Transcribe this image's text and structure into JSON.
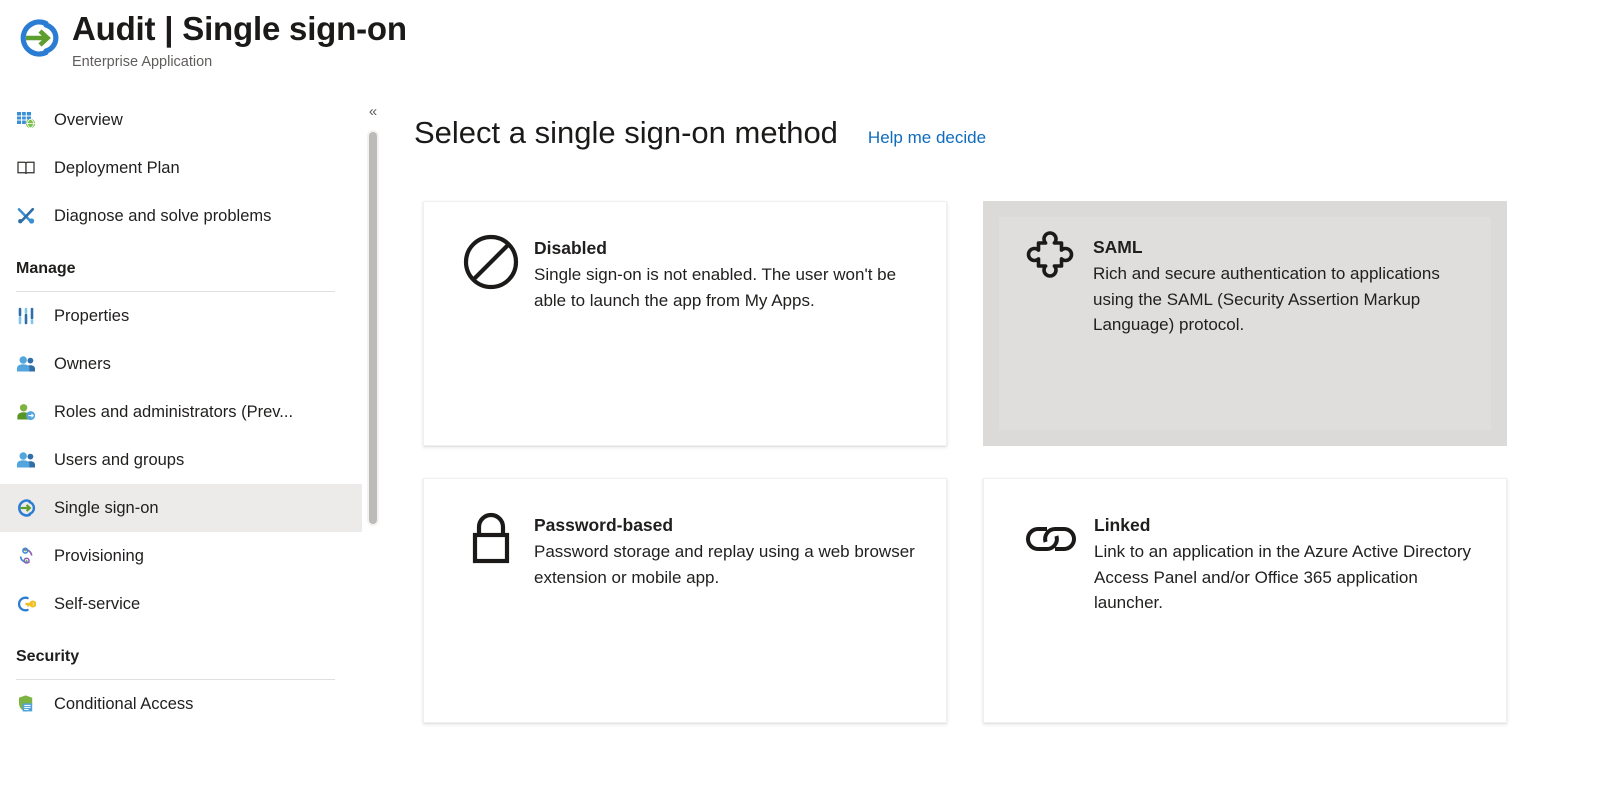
{
  "header": {
    "title": "Audit | Single sign-on",
    "subtitle": "Enterprise Application",
    "logo_icon": "single-sign-on-logo-icon"
  },
  "sidebar": {
    "items": [
      {
        "label": "Overview",
        "icon": "overview-grid-globe-icon",
        "selected": false
      },
      {
        "label": "Deployment Plan",
        "icon": "book-icon",
        "selected": false
      },
      {
        "label": "Diagnose and solve problems",
        "icon": "wrench-screwdriver-icon",
        "selected": false
      }
    ],
    "groups": [
      {
        "title": "Manage",
        "items": [
          {
            "label": "Properties",
            "icon": "sliders-icon",
            "selected": false
          },
          {
            "label": "Owners",
            "icon": "people-icon",
            "selected": false
          },
          {
            "label": "Roles and administrators (Prev...",
            "icon": "person-badge-icon",
            "selected": false
          },
          {
            "label": "Users and groups",
            "icon": "people-icon",
            "selected": false
          },
          {
            "label": "Single sign-on",
            "icon": "single-sign-on-icon",
            "selected": true
          },
          {
            "label": "Provisioning",
            "icon": "provisioning-cycle-icon",
            "selected": false
          },
          {
            "label": "Self-service",
            "icon": "key-circle-icon",
            "selected": false
          }
        ]
      },
      {
        "title": "Security",
        "items": [
          {
            "label": "Conditional Access",
            "icon": "shield-document-icon",
            "selected": false
          }
        ]
      }
    ]
  },
  "splitter": {
    "collapse_icon": "chevron-double-left-icon",
    "collapse_glyph": "«"
  },
  "main": {
    "title": "Select a single sign-on method",
    "help_link": "Help me decide",
    "cards": [
      {
        "title": "Disabled",
        "description": "Single sign-on is not enabled. The user won't be able to launch the app from My Apps.",
        "icon": "no-entry-icon",
        "highlighted": false
      },
      {
        "title": "SAML",
        "description": "Rich and secure authentication to applications using the SAML (Security Assertion Markup Language) protocol.",
        "icon": "puzzle-piece-icon",
        "highlighted": true
      },
      {
        "title": "Password-based",
        "description": "Password storage and replay using a web browser extension or mobile app.",
        "icon": "padlock-icon",
        "highlighted": false
      },
      {
        "title": "Linked",
        "description": "Link to an application in the Azure Active Directory Access Panel and/or Office 365 application launcher.",
        "icon": "chain-link-icon",
        "highlighted": false
      }
    ]
  },
  "colors": {
    "accent_link": "#0f6cbd",
    "selected_nav": "#edebe9",
    "card_highlight": "#dfdedd",
    "logo_blue": "#2b7cd3",
    "logo_green": "#5e9e2e"
  }
}
